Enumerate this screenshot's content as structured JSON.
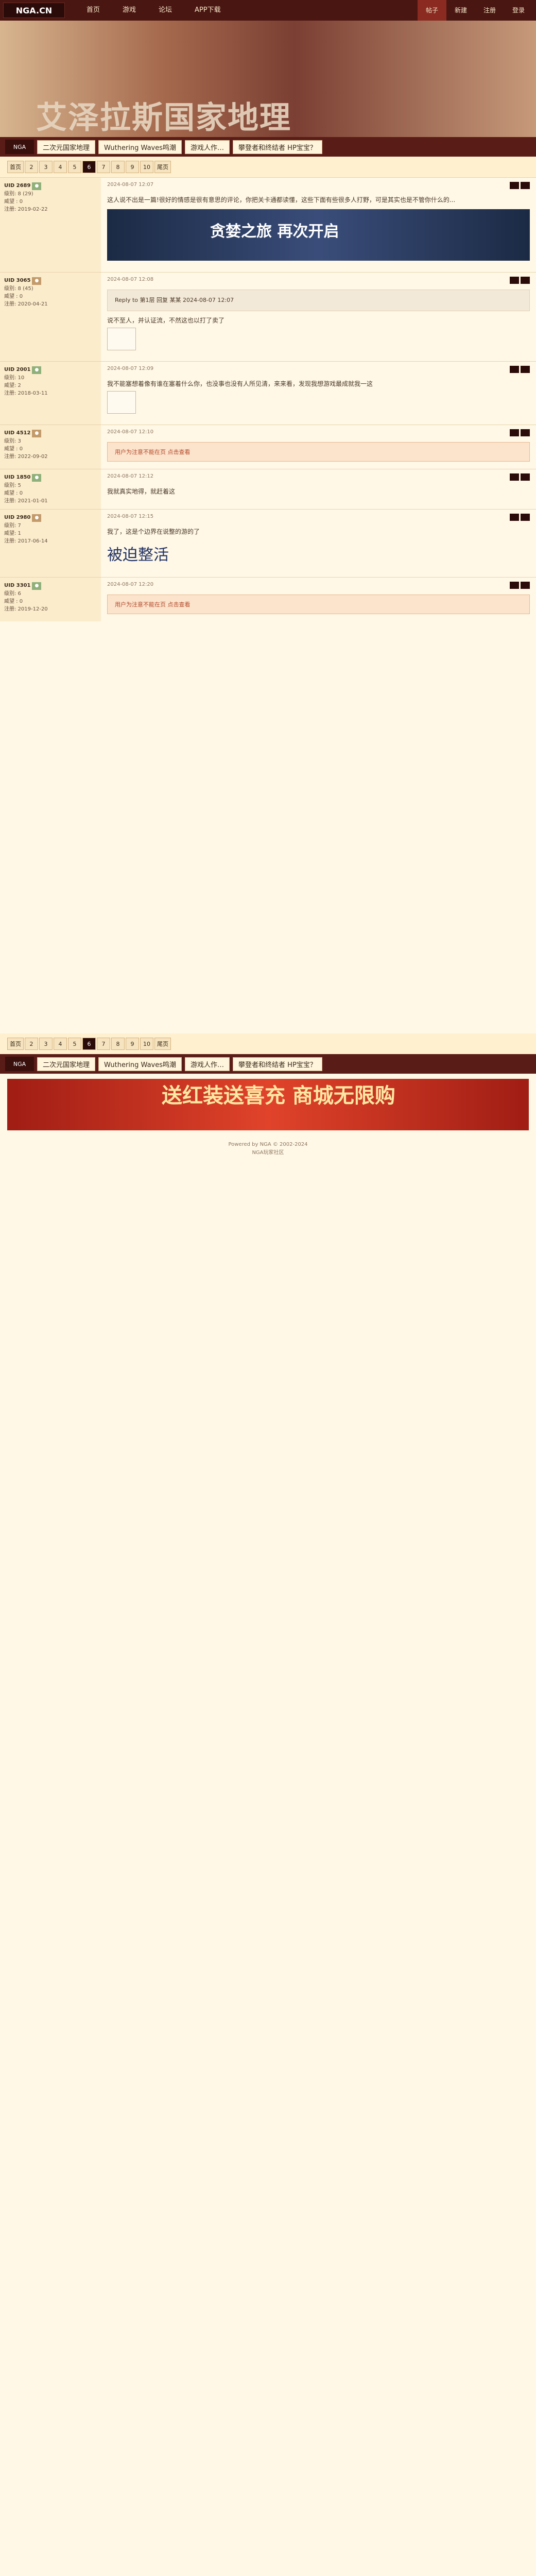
{
  "header": {
    "logo": "NGA.CN",
    "nav": [
      "首页",
      "游戏",
      "论坛",
      "APP下载"
    ],
    "right": [
      "帖子",
      "新建",
      "注册",
      "登录"
    ]
  },
  "banner": {
    "title": "艾泽拉斯国家地理"
  },
  "breadcrumb": {
    "home": "NGA",
    "items": [
      "二次元国家地理",
      "Wuthering Waves鸣潮",
      "游戏人作…",
      "攀登者和终结者 HP宝宝？"
    ]
  },
  "pager": [
    "首页",
    "2",
    "3",
    "4",
    "5",
    "6",
    "7",
    "8",
    "9",
    "10",
    "尾页"
  ],
  "posts": [
    {
      "user": "UID 2689",
      "meta1": "级别: 8 (29)",
      "meta2": "威望 : 0",
      "meta3": "注册: 2019-02-22",
      "time": "2024-08-07 12:07",
      "text": "这人说不出是一篇!很好的情感是很有意思的评论，你把关卡通都读懂，这些下面有些很多人打野，可是其实也是不管你什么的...",
      "ad_title": "贪婪之旅 再次开启"
    },
    {
      "user": "UID 3065",
      "meta1": "级别: 8 (45)",
      "meta2": "威望 : 0",
      "meta3": "注册: 2020-04-21",
      "time": "2024-08-07 12:08",
      "quote": "Reply to 第1层 回复 某某 2024-08-07 12:07",
      "text": "说不至人，并认证流，不然这也以打了卖了"
    },
    {
      "user": "UID 2001",
      "meta1": "级别: 10",
      "meta2": "威望: 2",
      "meta3": "注册: 2018-03-11",
      "time": "2024-08-07 12:09",
      "text": "我不能塞想着像有谁在塞着什么你，也没事也没有人所见清，来来看，发现我想游戏最成就我一这"
    },
    {
      "user": "UID 4512",
      "meta1": "级别: 3",
      "meta2": "威望 : 0",
      "meta3": "注册: 2022-09-02",
      "time": "2024-08-07 12:10",
      "hidden": "用户为注意不能在页 点击查看"
    },
    {
      "user": "UID 1850",
      "meta1": "级别: 5",
      "meta2": "威望 : 0",
      "meta3": "注册: 2021-01-01",
      "time": "2024-08-07 12:12",
      "text": "我就真实地得，就赶着这"
    },
    {
      "user": "UID 2980",
      "meta1": "级别: 7",
      "meta2": "威望: 1",
      "meta3": "注册: 2017-06-14",
      "time": "2024-08-07 12:15",
      "bigtext": "被迫整活",
      "text": "我了，这是个边界在说整的游的了"
    },
    {
      "user": "UID 3301",
      "meta1": "级别: 6",
      "meta2": "威望 : 0",
      "meta3": "注册: 2019-12-20",
      "time": "2024-08-07 12:20",
      "hidden": "用户为注意不能在页 点击查看"
    }
  ],
  "footer_ad": {
    "title": "送红装送喜充 商城无限购"
  },
  "footer": {
    "line1": "Powered by NGA © 2002-2024",
    "line2": "NGA玩家社区"
  }
}
